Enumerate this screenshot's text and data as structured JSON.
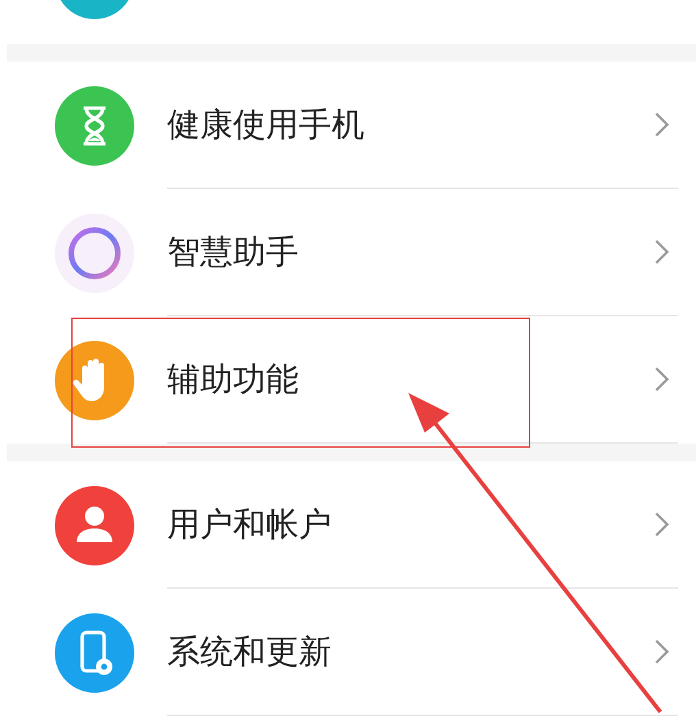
{
  "sections": [
    {
      "items": [
        {
          "kind": "hourglass",
          "label": "健康使用手机",
          "highlighted": false
        },
        {
          "kind": "ring",
          "label": "智慧助手",
          "highlighted": false
        },
        {
          "kind": "hand",
          "label": "辅助功能",
          "highlighted": true
        }
      ]
    },
    {
      "items": [
        {
          "kind": "person",
          "label": "用户和帐户",
          "highlighted": false
        },
        {
          "kind": "phone-gear",
          "label": "系统和更新",
          "highlighted": false
        }
      ]
    }
  ]
}
